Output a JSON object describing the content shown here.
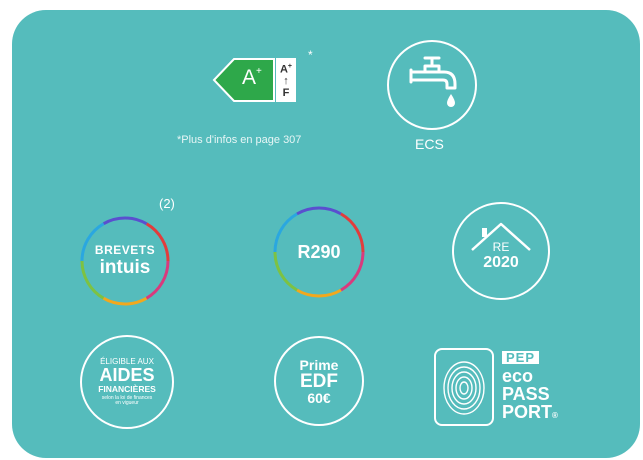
{
  "energy_label": {
    "class": "A",
    "class_sup": "+",
    "scale_top": "A",
    "scale_top_sup": "+",
    "scale_arrow": "↑",
    "scale_bottom": "F",
    "asterisk": "*",
    "note": "*Plus d'infos en page 307",
    "colors": {
      "arrow": "#2ea84a",
      "border": "#ffffff"
    }
  },
  "ecs": {
    "label": "ECS",
    "icon": "faucet-icon"
  },
  "brevets": {
    "footnote": "(2)",
    "line1": "BREVETS",
    "line2": "intuis",
    "icon": "rainbow-ring-icon"
  },
  "r290": {
    "label": "R290",
    "icon": "rainbow-ring-icon"
  },
  "re2020": {
    "line1": "RE",
    "line2": "2020",
    "icon": "house-roof-icon"
  },
  "aides": {
    "line1": "ÉLIGIBLE AUX",
    "line2": "AIDES",
    "line3": "FINANCIÈRES",
    "line4": "selon la loi de finances",
    "line5": "en vigueur"
  },
  "prime": {
    "line1": "Prime",
    "line2": "EDF",
    "line3": "60€"
  },
  "pep": {
    "line1": "PEP",
    "line2": "eco",
    "line3": "PASS",
    "line4": "PORT",
    "reg": "®",
    "icon": "fingerprint-icon"
  },
  "colors": {
    "background": "#55bcbc",
    "foreground": "#ffffff"
  }
}
